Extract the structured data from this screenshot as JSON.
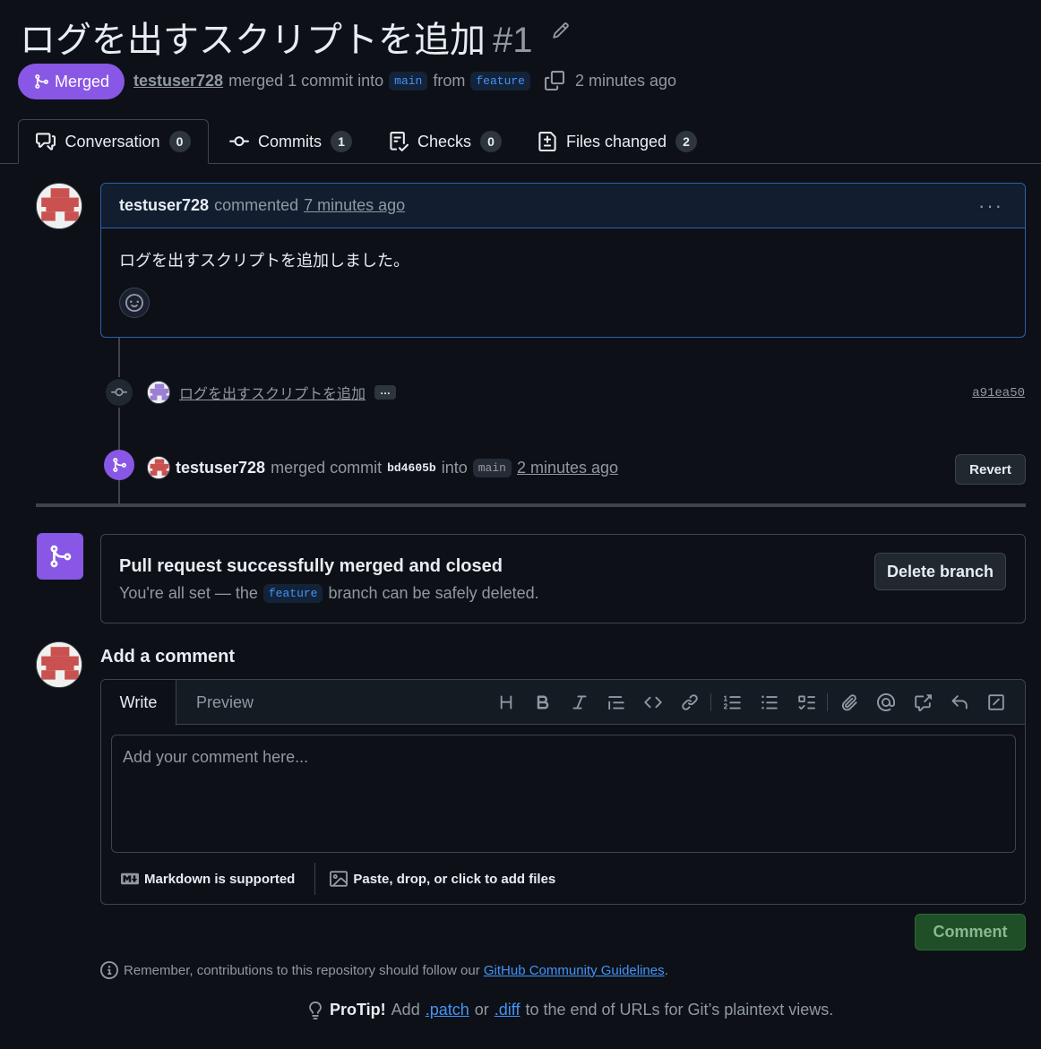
{
  "pr": {
    "title": "ログを出すスクリプトを追加",
    "number": "#1",
    "state": "Merged",
    "author": "testuser728",
    "action_text": "merged 1 commit into",
    "base_branch": "main",
    "from_text": "from",
    "head_branch": "feature",
    "time": "2 minutes ago"
  },
  "tabs": [
    {
      "label": "Conversation",
      "count": "0"
    },
    {
      "label": "Commits",
      "count": "1"
    },
    {
      "label": "Checks",
      "count": "0"
    },
    {
      "label": "Files changed",
      "count": "2"
    }
  ],
  "comment": {
    "author": "testuser728",
    "verb": "commented",
    "time": "7 minutes ago",
    "body": "ログを出すスクリプトを追加しました。",
    "more": "···"
  },
  "commit": {
    "message": "ログを出すスクリプトを追加",
    "ellipsis": "…",
    "sha": "a91ea50"
  },
  "merge_event": {
    "author": "testuser728",
    "verb": "merged commit",
    "sha": "bd4605b",
    "into": "into",
    "branch": "main",
    "time": "2 minutes ago",
    "revert_label": "Revert"
  },
  "merged_box": {
    "title": "Pull request successfully merged and closed",
    "sub_prefix": "You're all set — the",
    "branch": "feature",
    "sub_suffix": "branch can be safely deleted.",
    "delete_label": "Delete branch"
  },
  "add_comment": {
    "title": "Add a comment",
    "tab_write": "Write",
    "tab_preview": "Preview",
    "placeholder": "Add your comment here...",
    "markdown_note": "Markdown is supported",
    "files_note": "Paste, drop, or click to add files",
    "submit_label": "Comment"
  },
  "footer": {
    "guidelines_prefix": "Remember, contributions to this repository should follow our",
    "guidelines_link": "GitHub Community Guidelines",
    "guidelines_suffix": ".",
    "protip_label": "ProTip!",
    "protip_1": "Add",
    "protip_patch": ".patch",
    "protip_2": "or",
    "protip_diff": ".diff",
    "protip_3": "to the end of URLs for Git’s plaintext views."
  },
  "colors": {
    "merged": "#8957e5",
    "link": "#4493f8",
    "background": "#0d1117",
    "comment_button": "#1e4f26"
  }
}
